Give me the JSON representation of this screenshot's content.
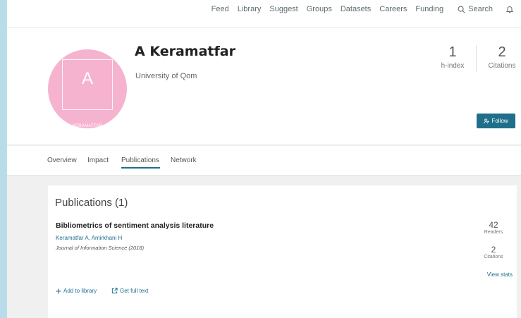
{
  "nav": {
    "items": [
      "Feed",
      "Library",
      "Suggest",
      "Groups",
      "Datasets",
      "Careers",
      "Funding"
    ],
    "search_label": "Search"
  },
  "profile": {
    "name": "A Keramatfar",
    "affiliation": "University of Qom",
    "avatar_initial": "A",
    "avatar_name": "KERAMATFAR",
    "avatar_color": "#f6b3cf",
    "h_index": "1",
    "h_index_label": "h-index",
    "citations": "2",
    "citations_label": "Citations",
    "follow_label": "Follow"
  },
  "tabs": [
    "Overview",
    "Impact",
    "Publications",
    "Network"
  ],
  "active_tab": "Publications",
  "publications": {
    "heading": "Publications (1)",
    "items": [
      {
        "title": "Bibliometrics of sentiment analysis literature",
        "authors": "Keramatfar A, Amirkhani H",
        "journal": "Journal of Information Science (2018)",
        "readers": "42",
        "readers_label": "Readers",
        "citations": "2",
        "citations_label": "Citations",
        "view_stats": "View stats",
        "add_to_library": "Add to library",
        "get_full_text": "Get full text"
      }
    ]
  },
  "colors": {
    "accent": "#1f6f8b",
    "outer_background": "#b9dde8",
    "page_background": "#f0f0f0"
  }
}
